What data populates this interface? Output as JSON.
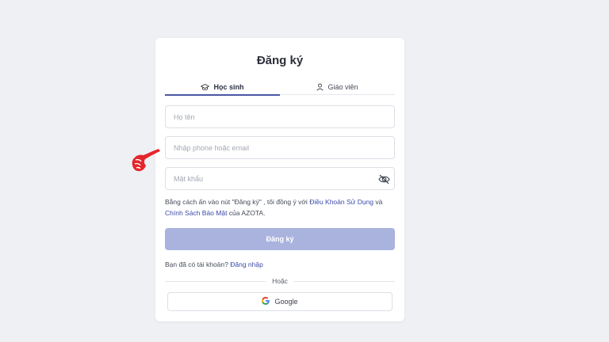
{
  "form": {
    "title": "Đăng ký",
    "tabs": [
      {
        "label": "Học sinh",
        "icon": "graduation-cap-icon",
        "active": true
      },
      {
        "label": "Giáo viên",
        "icon": "user-icon",
        "active": false
      }
    ],
    "fields": {
      "name": {
        "placeholder": "Họ tên",
        "value": ""
      },
      "contact": {
        "placeholder": "Nhập phone hoặc email",
        "value": ""
      },
      "password": {
        "placeholder": "Mật khẩu",
        "value": "",
        "toggle_icon": "eye-off-icon"
      }
    },
    "terms": {
      "prefix": "Bằng cách ấn vào nút \"Đăng ký\" , tôi đồng ý với ",
      "link1": "Điều Khoản Sử Dụng",
      "middle": " và ",
      "link2": "Chính Sách Bảo Mật",
      "suffix": " của AZOTA."
    },
    "submit_label": "Đăng ký",
    "login_prompt": "Bạn đã có tài khoản?",
    "login_link": "Đăng nhập",
    "divider_label": "Hoặc",
    "google_label": "Google"
  },
  "colors": {
    "background": "#eef0f4",
    "accent": "#4a57a5",
    "link": "#3b4aa8",
    "submit_disabled": "#a9b3de",
    "pointer": "#e5262b"
  }
}
